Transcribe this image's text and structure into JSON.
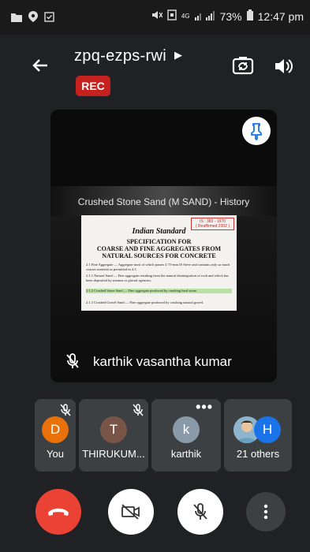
{
  "status_bar": {
    "network": "4G",
    "battery": "73%",
    "time": "12:47 pm"
  },
  "header": {
    "meeting_code": "zpq-ezps-rwi",
    "rec_label": "REC"
  },
  "presentation": {
    "slide_heading": "Crushed Stone Sand (M SAND) - History",
    "doc_ref_line1": "IS : 383 - 1970",
    "doc_ref_line2": "( Reaffirmed 2002 )",
    "doc_title": "Indian Standard",
    "doc_sub1": "SPECIFICATION FOR",
    "doc_sub2": "COARSE AND FINE AGGREGATES FROM",
    "doc_sub3": "NATURAL SOURCES FOR CONCRETE",
    "doc_p1": "2.1 Fine Aggregate — Aggregate most of which passes 4·75-mm IS Sieve and contains only so much coarser material as permitted in 4.3.",
    "doc_p2": "2.1.1 Natural Sand — Fine aggregate resulting from the natural disintegration of rock and which has been deposited by streams or glacial agencies.",
    "doc_p3": "2.1.2 Crushed Stone Sand — Fine aggregate produced by crushing hard stone.",
    "doc_p4": "2.1.3 Crushed Gravel Sand — Fine aggregate produced by crushing natural gravel.",
    "speaker_name": "karthik vasantha kumar"
  },
  "participants": [
    {
      "initial": "D",
      "label": "You",
      "color": "#e8710a"
    },
    {
      "initial": "T",
      "label": "THIRUKUM...",
      "color": "#795548"
    },
    {
      "initial": "k",
      "label": "karthik",
      "color": "#8a9aa8"
    },
    {
      "initial": "H",
      "label": "21 others",
      "color": "#1a73e8"
    }
  ],
  "controls": {
    "end_call": "end-call",
    "camera": "camera-off",
    "mic": "mic-off",
    "more": "more-options"
  }
}
